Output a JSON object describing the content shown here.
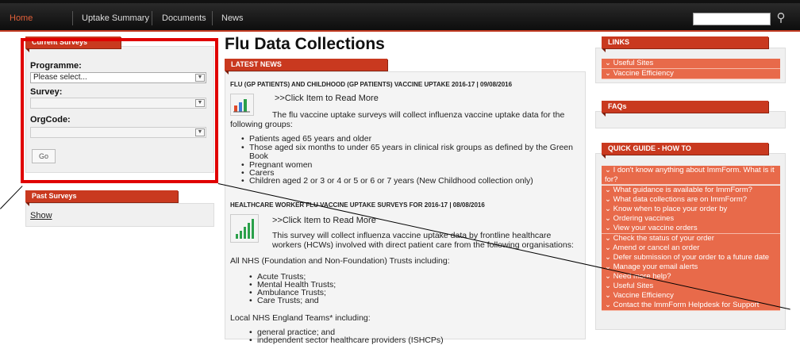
{
  "nav": {
    "items": [
      "Home",
      "Uptake Summary",
      "Documents",
      "News"
    ]
  },
  "left": {
    "current_title": "Current Surveys",
    "programme_label": "Programme:",
    "programme_value": "Please select...",
    "survey_label": "Survey:",
    "orgcode_label": "OrgCode:",
    "go_label": "Go",
    "past_title": "Past Surveys",
    "show_link": "Show"
  },
  "main": {
    "title": "Flu Data Collections",
    "latest_news": "LATEST NEWS",
    "news1": {
      "heading": "FLU (GP PATIENTS) AND CHILDHOOD (GP PATIENTS) VACCINE UPTAKE 2016-17 | 09/08/2016",
      "read_more": ">>Click Item to Read More",
      "intro": "The flu vaccine uptake surveys will collect influenza vaccine uptake data for the following groups:",
      "bullets": [
        "Patients aged 65 years and older",
        "Those aged six months to under 65 years in clinical risk groups as defined by the Green Book",
        "Pregnant women",
        "Carers",
        "Children aged 2 or 3 or 4 or 5 or 6 or 7 years (New Childhood collection only)"
      ]
    },
    "news2": {
      "heading": "HEALTHCARE WORKER FLU VACCINE UPTAKE SURVEYS FOR 2016-17 | 08/08/2016",
      "read_more": ">>Click Item to Read More",
      "intro": "This survey will collect influenza vaccine uptake data by frontline healthcare workers (HCWs) involved with direct patient care from the following organisations:",
      "trusts_intro": "All NHS (Foundation and Non-Foundation) Trusts including:",
      "trusts": [
        "Acute Trusts;",
        "Mental Health Trusts;",
        "Ambulance Trusts;",
        "Care Trusts; and"
      ],
      "local_intro": "Local NHS England Teams* including:",
      "local": [
        "general practice; and",
        "independent sector healthcare providers (ISHCPs)"
      ]
    }
  },
  "right": {
    "links_title": "LINKS",
    "links": [
      "Useful Sites",
      "Vaccine Efficiency"
    ],
    "faqs_title": "FAQs",
    "guide_title": "QUICK GUIDE - HOW TO",
    "guide": [
      "I don't know anything about ImmForm. What is it for?",
      "What guidance is available for ImmForm?",
      "What data collections are on ImmForm?",
      "Know when to place your order by",
      "Ordering vaccines",
      "View your vaccine orders",
      "Check the status of your order",
      "Amend or cancel an order",
      "Defer submission of your order to a future date",
      "Manage your email alerts",
      "Need more help?",
      "Useful Sites",
      "Vaccine Efficiency",
      "Contact the ImmForm Helpdesk for Support"
    ]
  },
  "colors": {
    "accent": "#c9391f",
    "link_bg": "#e86a4a",
    "highlight": "#e00000"
  },
  "icons": {
    "search": "search-icon",
    "chevron": "chevron-down-icon"
  }
}
